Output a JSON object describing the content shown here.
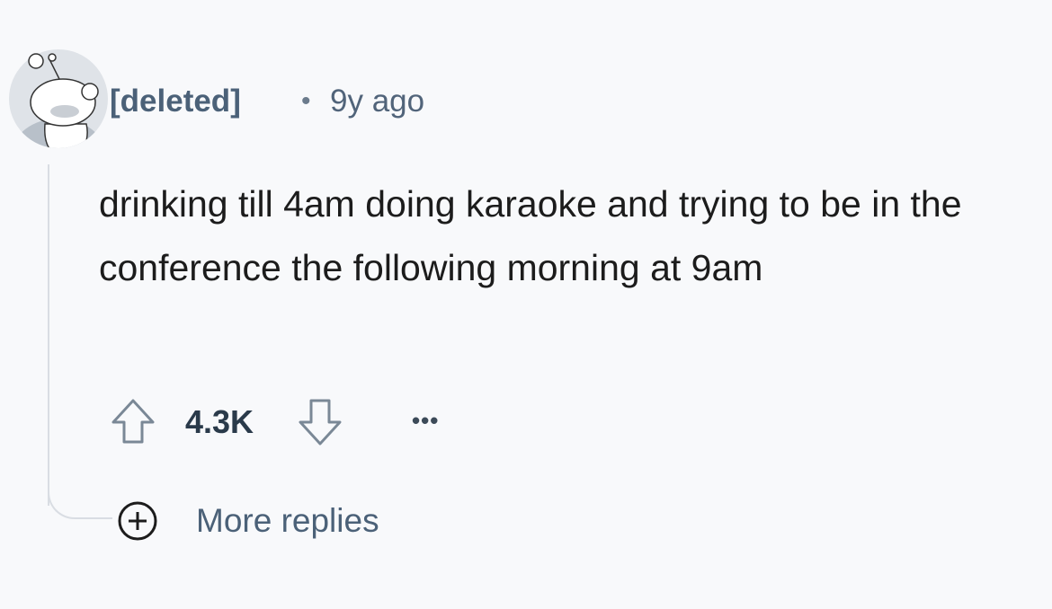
{
  "comment": {
    "author": "[deleted]",
    "separator": "•",
    "timestamp": "9y ago",
    "text": "drinking till 4am doing karaoke and trying to be in the conference the following morning at 9am",
    "score": "4.3K",
    "more_options": "•••",
    "more_replies_label": "More replies"
  },
  "icons": {
    "avatar": "snoo-avatar",
    "upvote": "arrow-up-icon",
    "downvote": "arrow-down-icon",
    "more_replies": "plus-circle-icon"
  },
  "colors": {
    "background": "#f8f9fb",
    "author": "#4b6178",
    "text": "#1c1c1c",
    "thread_line": "#d9dde3"
  }
}
